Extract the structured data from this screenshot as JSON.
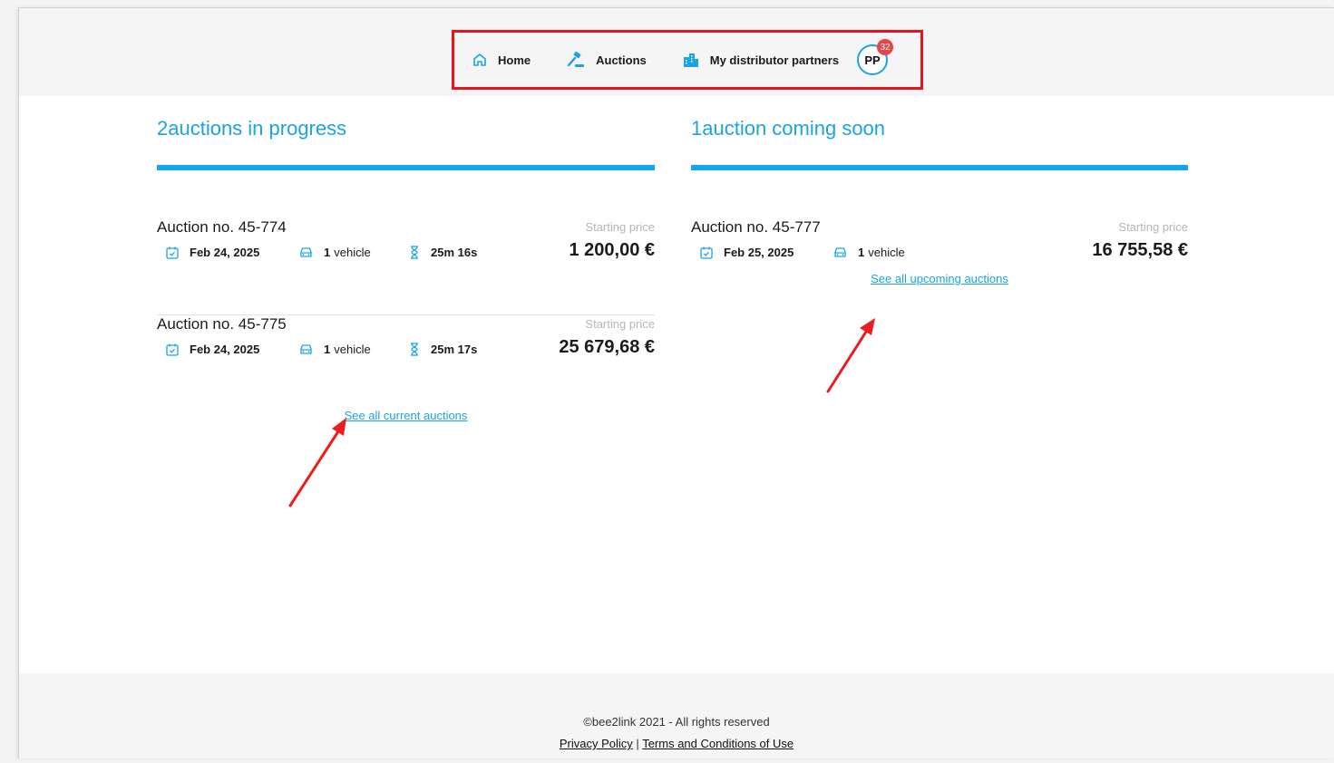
{
  "nav": {
    "home": "Home",
    "auctions": "Auctions",
    "partners": "My distributor partners",
    "avatar_initials": "PP",
    "notification_count": "32"
  },
  "colors": {
    "accent": "#1aa3e6",
    "highlight_box": "#e8141c",
    "badge": "#e8444a"
  },
  "in_progress": {
    "heading": "2auctions in progress",
    "auctions": [
      {
        "title": "Auction no. 45-774",
        "date": "Feb 24, 2025",
        "vehicle_count": "1",
        "vehicle_label": "vehicle",
        "timer": "25m 16s",
        "price_label": "Starting price",
        "price": "1 200,00 €"
      },
      {
        "title": "Auction no. 45-775",
        "date": "Feb 24, 2025",
        "vehicle_count": "1",
        "vehicle_label": "vehicle",
        "timer": "25m 17s",
        "price_label": "Starting price",
        "price": "25 679,68 €"
      }
    ],
    "see_all": "See all current auctions"
  },
  "coming_soon": {
    "heading": "1auction coming soon",
    "auctions": [
      {
        "title": "Auction no. 45-777",
        "date": "Feb 25, 2025",
        "vehicle_count": "1",
        "vehicle_label": "vehicle",
        "price_label": "Starting price",
        "price": "16 755,58 €"
      }
    ],
    "see_all": "See all upcoming auctions"
  },
  "footer": {
    "copyright": "©bee2link 2021 - All rights reserved",
    "privacy": "Privacy Policy",
    "separator": "|",
    "terms": "Terms and Conditions of Use"
  }
}
